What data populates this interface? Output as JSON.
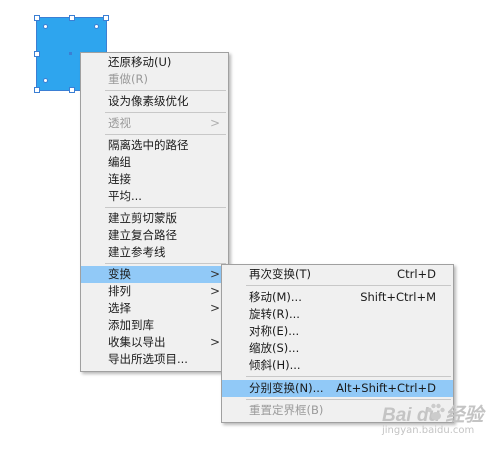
{
  "colors": {
    "shape_fill": "#2ea5ee",
    "selection_outline": "#3b7fd4",
    "menu_background": "#f0f0f0",
    "highlight": "#91c9f7",
    "disabled_text": "#9a9a9a"
  },
  "context_menu": {
    "items": [
      {
        "label": "还原移动(U)"
      },
      {
        "label": "重做(R)"
      },
      {
        "label": "设为像素级优化"
      },
      {
        "label": "透视",
        "submenu_icon": "chevron-right-icon"
      },
      {
        "label": "隔离选中的路径"
      },
      {
        "label": "编组"
      },
      {
        "label": "连接"
      },
      {
        "label": "平均..."
      },
      {
        "label": "建立剪切蒙版"
      },
      {
        "label": "建立复合路径"
      },
      {
        "label": "建立参考线"
      },
      {
        "label": "变换",
        "submenu_icon": "chevron-right-icon"
      },
      {
        "label": "排列",
        "submenu_icon": "chevron-right-icon"
      },
      {
        "label": "选择",
        "submenu_icon": "chevron-right-icon"
      },
      {
        "label": "添加到库"
      },
      {
        "label": "收集以导出",
        "submenu_icon": "chevron-right-icon"
      },
      {
        "label": "导出所选项目..."
      }
    ],
    "arrow_glyph": ">"
  },
  "transform_submenu": {
    "items": [
      {
        "label": "再次变换(T)",
        "shortcut": "Ctrl+D"
      },
      {
        "label": "移动(M)...",
        "shortcut": "Shift+Ctrl+M"
      },
      {
        "label": "旋转(R)..."
      },
      {
        "label": "对称(E)..."
      },
      {
        "label": "缩放(S)..."
      },
      {
        "label": "倾斜(H)..."
      },
      {
        "label": "分别变换(N)...",
        "shortcut": "Alt+Shift+Ctrl+D"
      },
      {
        "label": "重置定界框(B)"
      }
    ]
  },
  "watermark": {
    "logo": "Bai du 经验",
    "url": "jingyan.baidu.com"
  }
}
